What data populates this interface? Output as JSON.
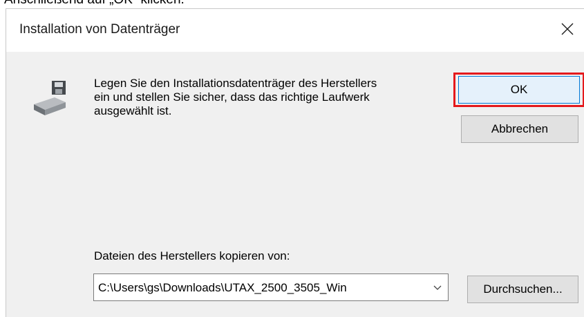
{
  "top_caption": "Anschließend auf „OK“ klicken.",
  "dialog": {
    "title": "Installation von Datenträger",
    "message_lines": [
      "Legen Sie den Installationsdatenträger des Herstellers",
      "ein und stellen Sie sicher, dass das richtige Laufwerk",
      "ausgewählt ist."
    ],
    "ok_label": "OK",
    "cancel_label": "Abbrechen",
    "copy_from_label": "Dateien des Herstellers kopieren von:",
    "path_value": "C:\\Users\\gs\\Downloads\\UTAX_2500_3505_Win",
    "browse_label": "Durchsuchen..."
  },
  "colors": {
    "highlight": "#e5191c",
    "focus_border": "#0078d7",
    "dialog_bg": "#f0f0f0"
  },
  "icons": [
    "close-icon",
    "drive-icon",
    "chevron-down-icon"
  ]
}
